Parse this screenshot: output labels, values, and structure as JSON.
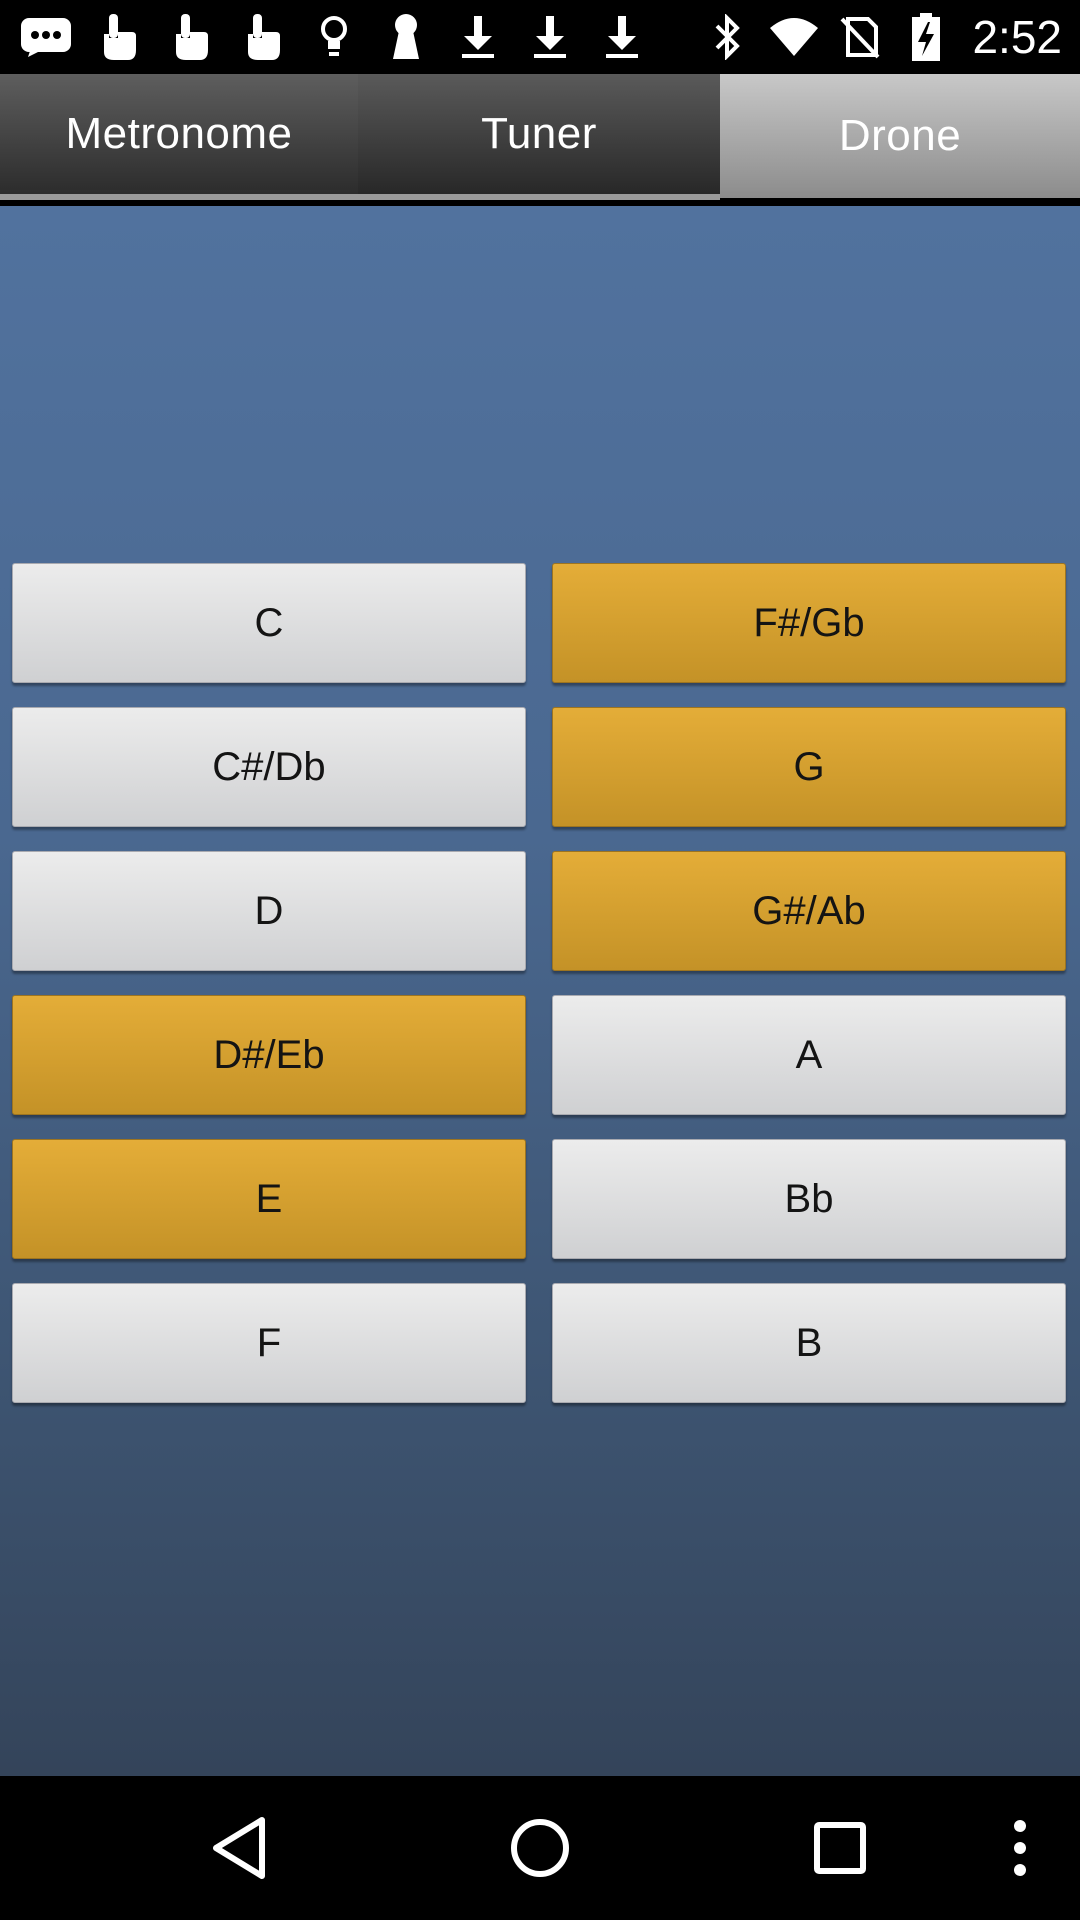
{
  "status_bar": {
    "time": "2:52",
    "left_icons": [
      "chat-bubble-icon",
      "touch-hand-icon",
      "touch-hand-icon",
      "touch-hand-icon",
      "lightbulb-icon",
      "keyhole-icon",
      "download-icon",
      "download-icon",
      "download-icon"
    ],
    "right_icons": [
      "bluetooth-icon",
      "wifi-icon",
      "no-sim-icon",
      "battery-charging-icon"
    ]
  },
  "tabs": [
    {
      "label": "Metronome",
      "selected": false
    },
    {
      "label": "Tuner",
      "selected": false
    },
    {
      "label": "Drone",
      "selected": true
    }
  ],
  "notes": {
    "left": [
      {
        "label": "C",
        "active": false
      },
      {
        "label": "C#/Db",
        "active": false
      },
      {
        "label": "D",
        "active": false
      },
      {
        "label": "D#/Eb",
        "active": true
      },
      {
        "label": "E",
        "active": true
      },
      {
        "label": "F",
        "active": false
      }
    ],
    "right": [
      {
        "label": "F#/Gb",
        "active": true
      },
      {
        "label": "G",
        "active": true
      },
      {
        "label": "G#/Ab",
        "active": true
      },
      {
        "label": "A",
        "active": false
      },
      {
        "label": "Bb",
        "active": false
      },
      {
        "label": "B",
        "active": false
      }
    ]
  },
  "colors": {
    "active_button": "#d9a433",
    "inactive_button": "#e0e0e2",
    "background_top": "#51729e",
    "background_bottom": "#34445a"
  },
  "nav_bar": {
    "icons": [
      "back-icon",
      "home-icon",
      "recents-icon",
      "overflow-menu-icon"
    ]
  }
}
